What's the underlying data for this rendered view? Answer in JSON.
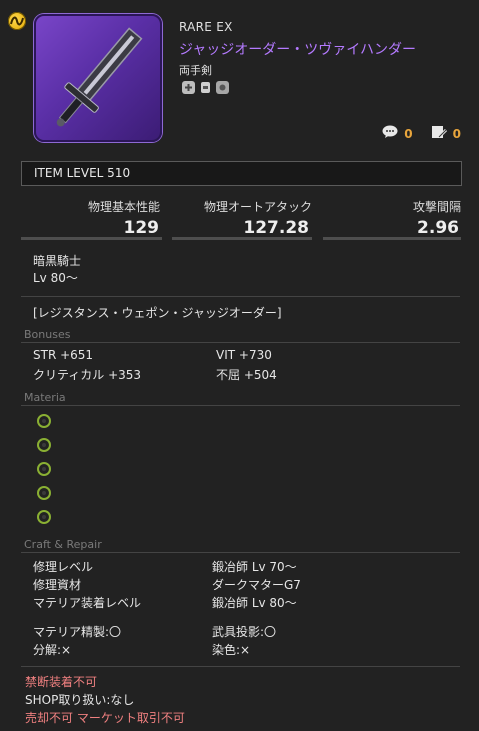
{
  "header": {
    "rarity": "RARE EX",
    "name": "ジャッジオーダー・ツヴァイハンダー",
    "category": "両手剣",
    "comments_count": "0",
    "reviews_count": "0"
  },
  "item_level": "ITEM LEVEL 510",
  "stats": [
    {
      "label": "物理基本性能",
      "value": "129"
    },
    {
      "label": "物理オートアタック",
      "value": "127.28"
    },
    {
      "label": "攻撃間隔",
      "value": "2.96"
    }
  ],
  "job": {
    "name": "暗黒騎士",
    "level": "Lv 80～"
  },
  "series": "[レジスタンス・ウェポン・ジャッジオーダー]",
  "bonuses": {
    "title": "Bonuses",
    "items": [
      {
        "label": "STR +651"
      },
      {
        "label": "VIT +730"
      },
      {
        "label": "クリティカル +353"
      },
      {
        "label": "不屈 +504"
      }
    ]
  },
  "materia": {
    "title": "Materia",
    "slots": 5
  },
  "craft": {
    "title": "Craft & Repair",
    "rows": [
      {
        "label": "修理レベル",
        "value": "鍛冶師 Lv 70～"
      },
      {
        "label": "修理資材",
        "value": "ダークマターG7"
      },
      {
        "label": "マテリア装着レベル",
        "value": "鍛冶師 Lv 80～"
      }
    ],
    "flags": [
      {
        "label": "マテリア精製:〇"
      },
      {
        "label": "武具投影:〇"
      },
      {
        "label": "分解:×"
      },
      {
        "label": "染色:×"
      }
    ]
  },
  "footer": {
    "restriction": "禁断装着不可",
    "shop": "SHOP取り扱い:なし",
    "trade": "売却不可 マーケット取引不可"
  },
  "colors": {
    "name": "#b47aff",
    "materia": "#8ab033",
    "counter": "#e8a53c",
    "warning": "#f08080"
  }
}
